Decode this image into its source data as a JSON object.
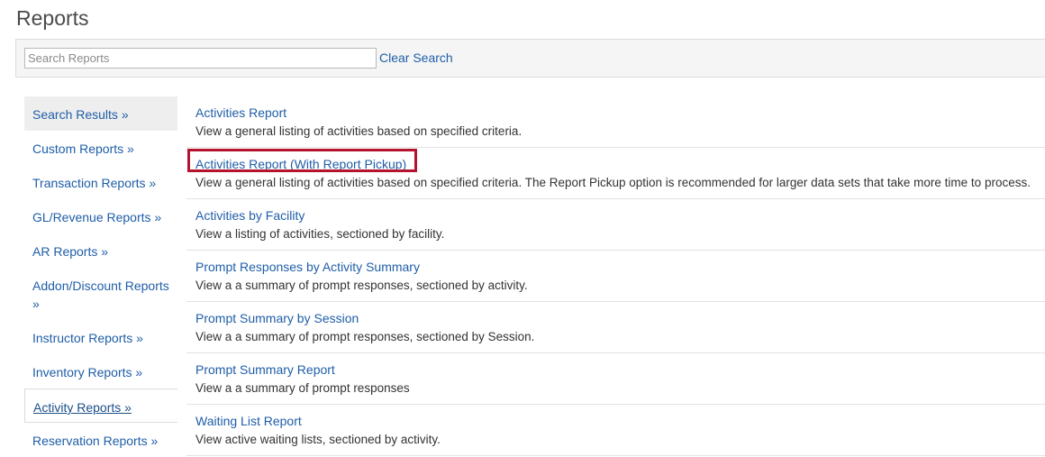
{
  "page": {
    "title": "Reports"
  },
  "search": {
    "placeholder": "Search Reports",
    "value": "",
    "clear_label": "Clear Search"
  },
  "sidebar": {
    "items": [
      {
        "label": "Search Results »"
      },
      {
        "label": "Custom Reports »"
      },
      {
        "label": "Transaction Reports »"
      },
      {
        "label": "GL/Revenue Reports »"
      },
      {
        "label": "AR Reports »"
      },
      {
        "label": "Addon/Discount Reports »"
      },
      {
        "label": "Instructor Reports »"
      },
      {
        "label": "Inventory Reports »"
      },
      {
        "label": "Activity Reports »"
      },
      {
        "label": "Reservation Reports »"
      }
    ]
  },
  "reports": [
    {
      "title": "Activities Report",
      "description": "View a general listing of activities based on specified criteria."
    },
    {
      "title": "Activities Report (With Report Pickup)",
      "description": "View a general listing of activities based on specified criteria. The Report Pickup option is recommended for larger data sets that take more time to process."
    },
    {
      "title": "Activities by Facility",
      "description": "View a listing of activities, sectioned by facility."
    },
    {
      "title": "Prompt Responses by Activity Summary",
      "description": "View a a summary of prompt responses, sectioned by activity."
    },
    {
      "title": "Prompt Summary by Session",
      "description": "View a a summary of prompt responses, sectioned by Session."
    },
    {
      "title": "Prompt Summary Report",
      "description": "View a a summary of prompt responses"
    },
    {
      "title": "Waiting List Report",
      "description": "View active waiting lists, sectioned by activity."
    }
  ],
  "colors": {
    "link": "#1f5ea8",
    "highlight": "#b5142e",
    "sidebar_selected_bg": "#eeeeee"
  }
}
